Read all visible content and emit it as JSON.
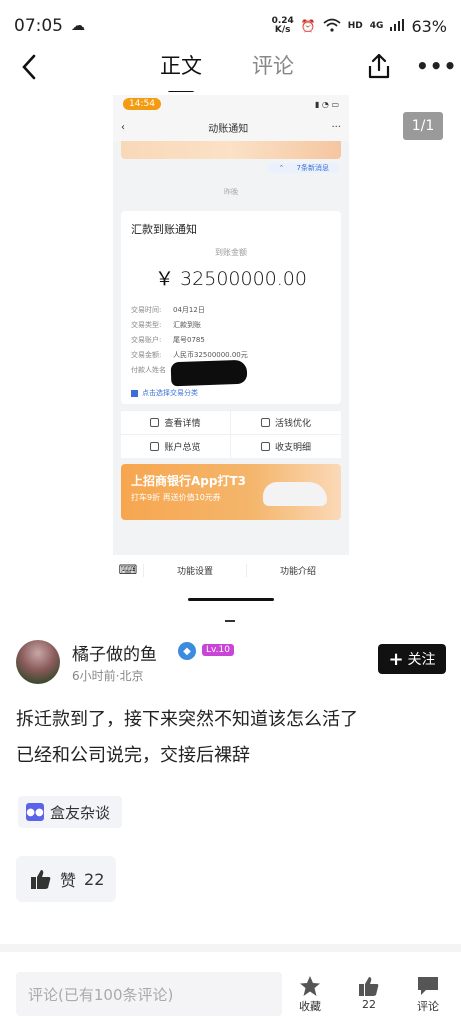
{
  "status_bar": {
    "time": "07:05",
    "speed_top": "0.24",
    "speed_bottom": "K/s",
    "network": "HD",
    "cell": "4G",
    "battery": "63%"
  },
  "header": {
    "tabs": [
      {
        "label": "正文",
        "active": true
      },
      {
        "label": "评论",
        "active": false
      }
    ]
  },
  "image": {
    "counter": "1/1",
    "screenshot": {
      "time": "14:54",
      "nav_title": "动账通知",
      "new_messages": "7条新消息",
      "date_label": "昨晚",
      "card_title": "汇款到账通知",
      "amount_label": "到账金额",
      "amount": "￥ 32500000.00",
      "rows": [
        {
          "key": "交易时间:",
          "value": "04月12日"
        },
        {
          "key": "交易类型:",
          "value": "汇款到账"
        },
        {
          "key": "交易账户:",
          "value": "尾号0785"
        },
        {
          "key": "交易金额:",
          "value": "人民币32500000.00元"
        },
        {
          "key": "付款人姓名",
          "value": ""
        }
      ],
      "category_link": "点击选择交易分类",
      "grid": [
        {
          "label": "查看详情"
        },
        {
          "label": "活钱优化"
        },
        {
          "label": "账户总览"
        },
        {
          "label": "收支明细"
        }
      ],
      "ad_title": "上招商银行App打T3",
      "ad_subtitle": "打车9折 再送价值10元券",
      "bottom_items": [
        "功能设置",
        "功能介绍"
      ]
    }
  },
  "author": {
    "name": "橘子做的鱼",
    "level": "Lv.10",
    "meta": "6小时前·北京",
    "follow_label": "关注"
  },
  "post": {
    "lines": [
      "拆迁款到了，接下来突然不知道该怎么活了",
      "已经和公司说完，交接后裸辞"
    ]
  },
  "tag": {
    "label": "盒友杂谈"
  },
  "like": {
    "label": "赞",
    "count": "22"
  },
  "bottom_bar": {
    "comment_placeholder": "评论(已有100条评论)",
    "favorite_label": "收藏",
    "like_count": "22",
    "comment_label": "评论"
  },
  "colors": {
    "accent_blue": "#3a6fd8",
    "level_badge": "#c845d8",
    "follow_bg": "#111111"
  }
}
